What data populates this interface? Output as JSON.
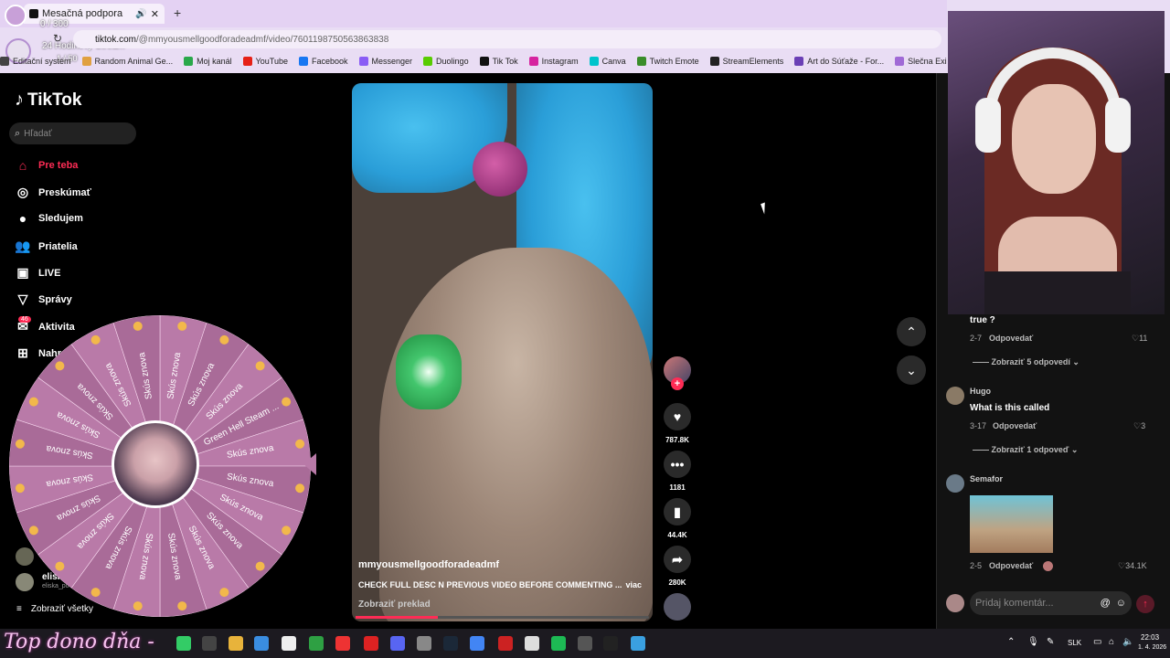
{
  "browser": {
    "tab_title": "Mesačná podpora",
    "url_prefix": "tiktok.com",
    "url_path": "/@mmyousmellgoodforadeadmf/video/7601198750563863838",
    "overlay_lines": [
      "0 / 300",
      "24 Hodinový Stream",
      "1 / 50"
    ],
    "bookmarks": [
      {
        "label": "Editační systém",
        "color": "#444"
      },
      {
        "label": "Random Animal Ge...",
        "color": "#e0a040"
      },
      {
        "label": "Moj kanál",
        "color": "#2aa84a"
      },
      {
        "label": "YouTube",
        "color": "#e62117"
      },
      {
        "label": "Facebook",
        "color": "#1877f2"
      },
      {
        "label": "Messenger",
        "color": "#8a5cf5"
      },
      {
        "label": "Duolingo",
        "color": "#58cc02"
      },
      {
        "label": "Tik Tok",
        "color": "#111"
      },
      {
        "label": "Instagram",
        "color": "#d6249f"
      },
      {
        "label": "Canva",
        "color": "#00c4cc"
      },
      {
        "label": "Twitch Emote",
        "color": "#3a8d2a"
      },
      {
        "label": "StreamElements",
        "color": "#222"
      },
      {
        "label": "Art do Súťaže - For...",
        "color": "#6a3fb5"
      },
      {
        "label": "Slečna Exis",
        "color": "#a06ad6"
      }
    ]
  },
  "tiktok": {
    "logo": "TikTok",
    "search_placeholder": "Hľadať",
    "nav": [
      {
        "label": "Pre teba",
        "icon": "home-icon",
        "glyph": "⌂"
      },
      {
        "label": "Preskúmať",
        "icon": "compass-icon",
        "glyph": "◎"
      },
      {
        "label": "Sledujem",
        "icon": "avatar-icon",
        "glyph": "●"
      },
      {
        "label": "Priatelia",
        "icon": "friends-icon",
        "glyph": "👥"
      },
      {
        "label": "LIVE",
        "icon": "live-icon",
        "glyph": "▣"
      },
      {
        "label": "Správy",
        "icon": "messages-icon",
        "glyph": "▽"
      },
      {
        "label": "Aktivita",
        "icon": "activity-icon",
        "glyph": "✉"
      },
      {
        "label": "Nahr",
        "icon": "upload-icon",
        "glyph": "⊞"
      }
    ],
    "activity_badge": "46",
    "following_user": "eliska",
    "following_handle": "eliska_po",
    "show_all": "Zobraziť všetky"
  },
  "wheel": {
    "center_text": "",
    "segments": [
      "Skús znova",
      "Skús znova",
      "Skús znova",
      "Green Hell Steam ...",
      "Skús znova",
      "Skús znova",
      "Skús znova",
      "Skús znova",
      "Skús znova",
      "Skús znova",
      "Skús znova",
      "Skús znova",
      "Skús znova",
      "Skús znova",
      "Skús znova",
      "Skús znova",
      "Skús znova",
      "Skús znova",
      "Skús znova",
      "Skús znova"
    ]
  },
  "video": {
    "author": "mmyousmellgoodforadeadmf",
    "caption": "CHECK FULL DESC N PREVIOUS VIDEO BEFORE COMMENTING ...",
    "more": "viac",
    "translate": "Zobraziť preklad",
    "progress": 0.28
  },
  "actions": {
    "likes": "787.8K",
    "comments": "1181",
    "saves": "44.4K",
    "shares": "280K"
  },
  "comments": [
    {
      "text": "true ?",
      "date": "2-7",
      "reply": "Odpovedať",
      "likes": "11",
      "view_replies": "Zobraziť 5 odpovedí"
    },
    {
      "user": "Hugo",
      "text": "What is this called",
      "date": "3-17",
      "reply": "Odpovedať",
      "likes": "3",
      "view_replies": "Zobraziť 1 odpoveď"
    },
    {
      "user": "Semafor",
      "date": "2-5",
      "reply": "Odpovedať",
      "likes": "34.1K"
    }
  ],
  "comment_input_placeholder": "Pridaj komentár...",
  "taskbar": {
    "overlay_text": "Top dono dňa -",
    "lang": "SLK",
    "time": "22:03",
    "date": "1. 4. 2026"
  },
  "colors": {
    "accent": "#fe2c55",
    "chrome": "#e9ddf4",
    "wheel": "#b97aa8"
  }
}
